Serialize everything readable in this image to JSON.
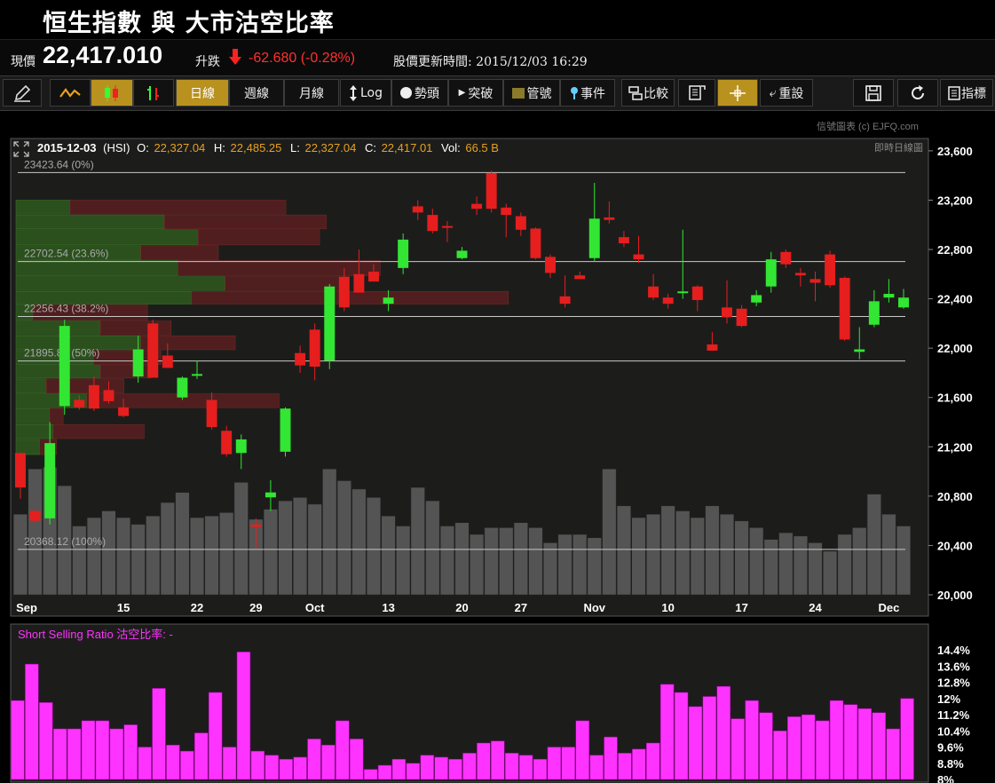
{
  "title": "恒生指數 與 大市沽空比率",
  "quote": {
    "price_label": "現價",
    "price": "22,417.010",
    "change_label": "升跌",
    "change": "-62.680 (-0.28%)",
    "updated_label": "股價更新時間:",
    "updated": "2015/12/03 16:29"
  },
  "toolbar": {
    "daily": "日線",
    "weekly": "週線",
    "monthly": "月線",
    "log": "Log",
    "trend": "勢頭",
    "breakout": "突破",
    "channel": "管號",
    "events": "事件",
    "compare": "比較",
    "reset": "重設",
    "indicators": "指標"
  },
  "credit": "信號圖表 (c) EJFQ.com",
  "colors": {
    "up": "#33e633",
    "down": "#e61e1e",
    "volume": "#545454",
    "ssr": "#ff33ff",
    "accent": "#b9911e"
  },
  "chart_data": [
    {
      "type": "candlestick",
      "info": {
        "date": "2015-12-03",
        "symbol": "(HSI)",
        "o_label": "O:",
        "o": "22,327.04",
        "h_label": "H:",
        "h": "22,485.25",
        "l_label": "L:",
        "l": "22,327.04",
        "c_label": "C:",
        "c": "22,417.01",
        "vol_label": "Vol:",
        "vol": "66.5 B"
      },
      "mode_label": "即時日線圖",
      "ylim": [
        20000,
        23700
      ],
      "yticks": [
        "20,000",
        "20,400",
        "20,800",
        "21,200",
        "21,600",
        "22,000",
        "22,400",
        "22,800",
        "23,200",
        "23,600"
      ],
      "ytick_values": [
        20000,
        20400,
        20800,
        21200,
        21600,
        22000,
        22400,
        22800,
        23200,
        23600
      ],
      "xticks": [
        {
          "label": "Sep",
          "i": 0
        },
        {
          "label": "15",
          "i": 7
        },
        {
          "label": "22",
          "i": 12
        },
        {
          "label": "29",
          "i": 16
        },
        {
          "label": "Oct",
          "i": 20
        },
        {
          "label": "13",
          "i": 25
        },
        {
          "label": "20",
          "i": 30
        },
        {
          "label": "27",
          "i": 34
        },
        {
          "label": "Nov",
          "i": 39
        },
        {
          "label": "10",
          "i": 44
        },
        {
          "label": "17",
          "i": 49
        },
        {
          "label": "24",
          "i": 54
        },
        {
          "label": "Dec",
          "i": 59
        }
      ],
      "fib_levels": [
        {
          "label": "23423.64 (0%)",
          "value": 23423.64
        },
        {
          "label": "22702.54 (23.6%)",
          "value": 22702.54
        },
        {
          "label": "22256.43 (38.2%)",
          "value": 22256.43
        },
        {
          "label": "21895.88 (50%)",
          "value": 21895.88
        },
        {
          "label": "20368.12 (100%)",
          "value": 20368.12
        }
      ],
      "candles": [
        [
          21150,
          21150,
          20780,
          20870
        ],
        [
          20680,
          20700,
          20580,
          20600
        ],
        [
          20620,
          21400,
          20570,
          21230
        ],
        [
          21530,
          22230,
          21460,
          22180
        ],
        [
          21580,
          21620,
          21500,
          21520
        ],
        [
          21700,
          21770,
          21490,
          21510
        ],
        [
          21660,
          21730,
          21550,
          21570
        ],
        [
          21520,
          21590,
          21440,
          21450
        ],
        [
          21770,
          22100,
          21720,
          21990
        ],
        [
          22200,
          22230,
          21760,
          21760
        ],
        [
          21940,
          22040,
          21840,
          21840
        ],
        [
          21600,
          21770,
          21580,
          21760
        ],
        [
          21780,
          21900,
          21750,
          21790
        ],
        [
          21580,
          21640,
          21340,
          21360
        ],
        [
          21330,
          21370,
          21120,
          21140
        ],
        [
          21150,
          21300,
          21020,
          21260
        ],
        [
          20570,
          20620,
          20380,
          20550
        ],
        [
          20790,
          20930,
          20680,
          20830
        ],
        [
          21160,
          21520,
          21120,
          21510
        ],
        [
          21960,
          22020,
          21800,
          21860
        ],
        [
          22150,
          22200,
          21740,
          21850
        ],
        [
          21900,
          22520,
          21830,
          22500
        ],
        [
          22580,
          22650,
          22300,
          22330
        ],
        [
          22600,
          22800,
          22500,
          22450
        ],
        [
          22620,
          22680,
          22550,
          22540
        ],
        [
          22360,
          22470,
          22300,
          22410
        ],
        [
          22650,
          22930,
          22600,
          22880
        ],
        [
          23150,
          23200,
          23040,
          23100
        ],
        [
          23080,
          23130,
          22930,
          22950
        ],
        [
          22990,
          23030,
          22860,
          22980
        ],
        [
          22730,
          22820,
          22720,
          22790
        ],
        [
          23170,
          23230,
          23080,
          23130
        ],
        [
          23420,
          23440,
          23100,
          23130
        ],
        [
          23140,
          23170,
          22900,
          23080
        ],
        [
          23070,
          23100,
          22910,
          22960
        ],
        [
          22970,
          22980,
          22720,
          22730
        ],
        [
          22740,
          22760,
          22570,
          22610
        ],
        [
          22420,
          22590,
          22330,
          22360
        ],
        [
          22590,
          22620,
          22560,
          22560
        ],
        [
          22730,
          23340,
          22700,
          23050
        ],
        [
          23060,
          23190,
          23010,
          23040
        ],
        [
          22900,
          22950,
          22820,
          22850
        ],
        [
          22760,
          22910,
          22690,
          22720
        ],
        [
          22500,
          22600,
          22390,
          22410
        ],
        [
          22410,
          22440,
          22320,
          22360
        ],
        [
          22460,
          22960,
          22400,
          22460
        ],
        [
          22500,
          22510,
          22300,
          22390
        ],
        [
          22030,
          22130,
          21980,
          21980
        ],
        [
          22330,
          22550,
          22200,
          22250
        ],
        [
          22320,
          22350,
          22170,
          22180
        ],
        [
          22370,
          22470,
          22340,
          22430
        ],
        [
          22500,
          22780,
          22450,
          22720
        ],
        [
          22780,
          22800,
          22650,
          22680
        ],
        [
          22610,
          22650,
          22500,
          22590
        ],
        [
          22560,
          22620,
          22380,
          22530
        ],
        [
          22760,
          22790,
          22490,
          22510
        ],
        [
          22570,
          22580,
          22060,
          22070
        ],
        [
          21970,
          22170,
          21910,
          21990
        ],
        [
          22190,
          22470,
          22170,
          22380
        ],
        [
          22410,
          22560,
          22370,
          22440
        ],
        [
          22330,
          22480,
          22320,
          22410
        ]
      ],
      "volumes": [
        48,
        75,
        76,
        65,
        41,
        46,
        50,
        46,
        42,
        47,
        55,
        61,
        46,
        47,
        49,
        67,
        45,
        51,
        56,
        58,
        54,
        75,
        68,
        63,
        58,
        47,
        41,
        64,
        56,
        41,
        43,
        36,
        40,
        40,
        43,
        40,
        31,
        36,
        36,
        34,
        75,
        53,
        46,
        48,
        53,
        50,
        46,
        53,
        48,
        44,
        40,
        33,
        37,
        35,
        31,
        26,
        36,
        40,
        60,
        48,
        41
      ],
      "volume_ylim": [
        0,
        100
      ],
      "volume_profile": [
        {
          "low": 23080,
          "high": 23200,
          "buy": 0.16,
          "sell": 0.64
        },
        {
          "low": 22960,
          "high": 23080,
          "buy": 0.44,
          "sell": 0.48
        },
        {
          "low": 22830,
          "high": 22960,
          "buy": 0.54,
          "sell": 0.36
        },
        {
          "low": 22710,
          "high": 22830,
          "buy": 0.37,
          "sell": 0.23
        },
        {
          "low": 22580,
          "high": 22710,
          "buy": 0.48,
          "sell": 0.6
        },
        {
          "low": 22460,
          "high": 22580,
          "buy": 0.62,
          "sell": 0.34
        },
        {
          "low": 22350,
          "high": 22460,
          "buy": 0.52,
          "sell": 0.94
        },
        {
          "low": 22220,
          "high": 22350,
          "buy": 0.05,
          "sell": 0.34
        },
        {
          "low": 22100,
          "high": 22220,
          "buy": 0.25,
          "sell": 0.21
        },
        {
          "low": 21980,
          "high": 22100,
          "buy": 0.37,
          "sell": 0.28
        },
        {
          "low": 21860,
          "high": 21980,
          "buy": 0.23,
          "sell": 0.2
        },
        {
          "low": 21750,
          "high": 21860,
          "buy": 0.25,
          "sell": 0.15
        },
        {
          "low": 21630,
          "high": 21750,
          "buy": 0.09,
          "sell": 0.23
        },
        {
          "low": 21510,
          "high": 21630,
          "buy": 0.21,
          "sell": 0.57
        },
        {
          "low": 21380,
          "high": 21510,
          "buy": 0.1,
          "sell": 0.04
        },
        {
          "low": 21260,
          "high": 21380,
          "buy": 0.11,
          "sell": 0.27
        },
        {
          "low": 21130,
          "high": 21260,
          "buy": 0.07,
          "sell": 0.05
        }
      ]
    },
    {
      "type": "bar",
      "title": "Short Selling Ratio 沽空比率: -",
      "ylim": [
        8,
        14.8
      ],
      "yticks": [
        "14.4%",
        "13.6%",
        "12.8%",
        "12%",
        "11.2%",
        "10.4%",
        "9.6%",
        "8.8%",
        "8%"
      ],
      "ytick_values": [
        14.4,
        13.6,
        12.8,
        12,
        11.2,
        10.4,
        9.6,
        8.8,
        8
      ],
      "values": [
        11.9,
        13.7,
        11.8,
        10.5,
        10.5,
        10.9,
        10.9,
        10.5,
        10.7,
        9.6,
        12.5,
        9.7,
        9.4,
        10.3,
        12.3,
        9.6,
        14.3,
        9.4,
        9.2,
        9.0,
        9.1,
        10.0,
        9.7,
        10.9,
        10.0,
        8.5,
        8.7,
        9.0,
        8.8,
        9.2,
        9.1,
        9.0,
        9.3,
        9.8,
        9.9,
        9.3,
        9.2,
        9.0,
        9.6,
        9.6,
        10.9,
        9.2,
        10.1,
        9.3,
        9.5,
        9.8,
        12.7,
        12.3,
        11.6,
        12.1,
        12.6,
        11.0,
        11.9,
        11.3,
        10.4,
        11.1,
        11.2,
        10.9,
        11.9,
        11.7,
        11.5,
        11.3,
        10.5,
        12.0
      ]
    }
  ]
}
